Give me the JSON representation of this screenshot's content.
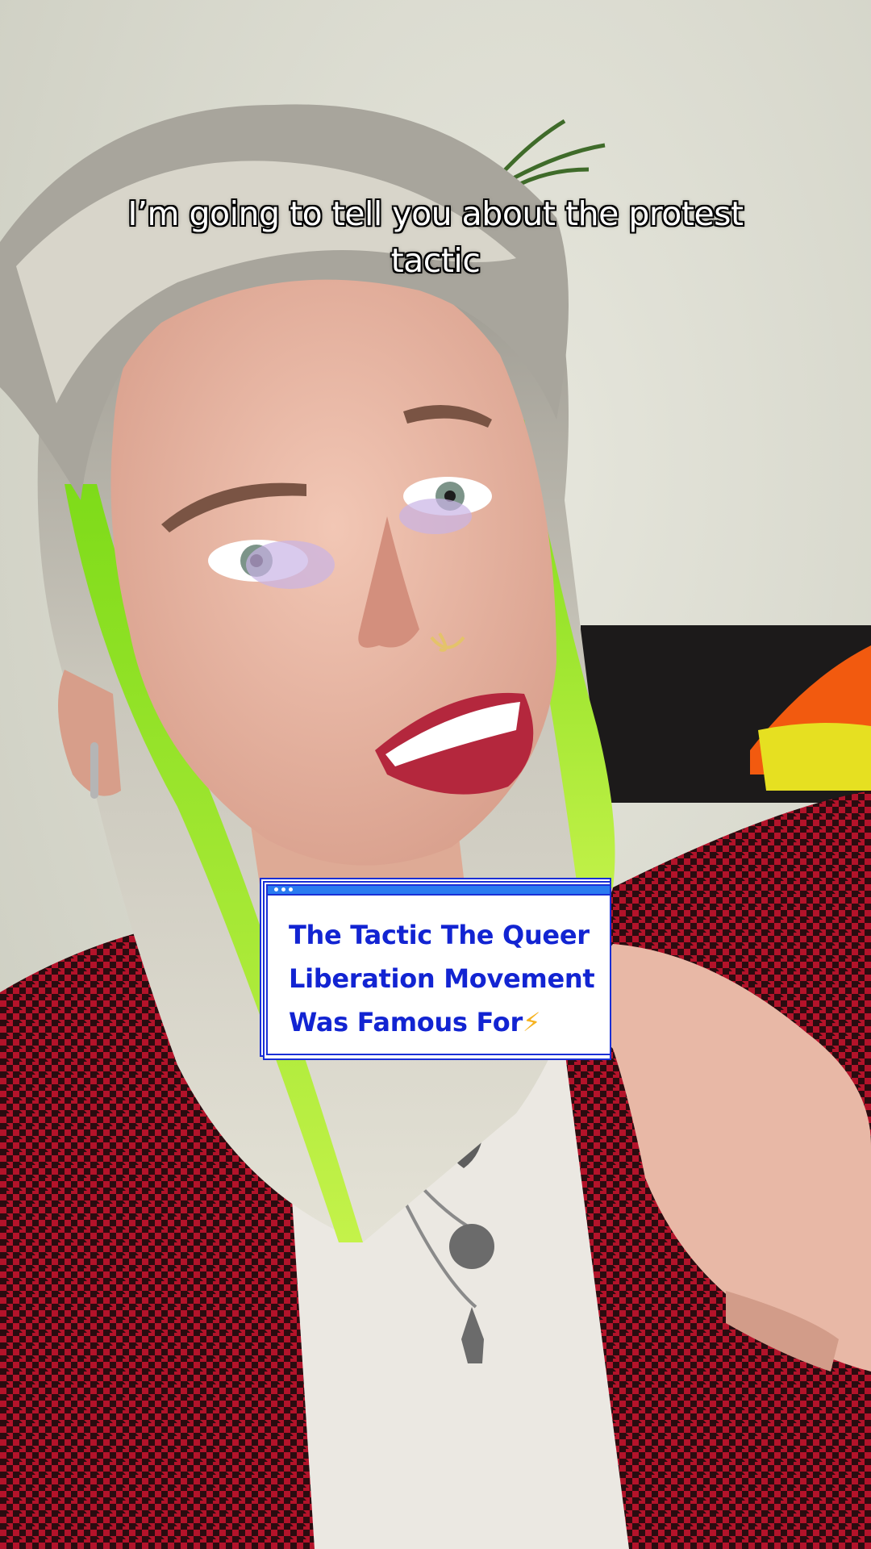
{
  "caption": {
    "line1": "I’m going to tell you about the protest",
    "line2": "tactic"
  },
  "title_card": {
    "title_line1": "The Tactic The Queer",
    "title_line2": "Liberation Movement",
    "title_line3": "Was Famous For",
    "emoji": "⚡"
  },
  "icons": {
    "card_bolt": "lightning-bolt-icon"
  },
  "colors": {
    "card_text": "#1224d2",
    "card_border": "#1a2fd6",
    "card_bar": "#2a7bf0",
    "caption_text": "#ffffff",
    "emoji": "#f6b320"
  }
}
